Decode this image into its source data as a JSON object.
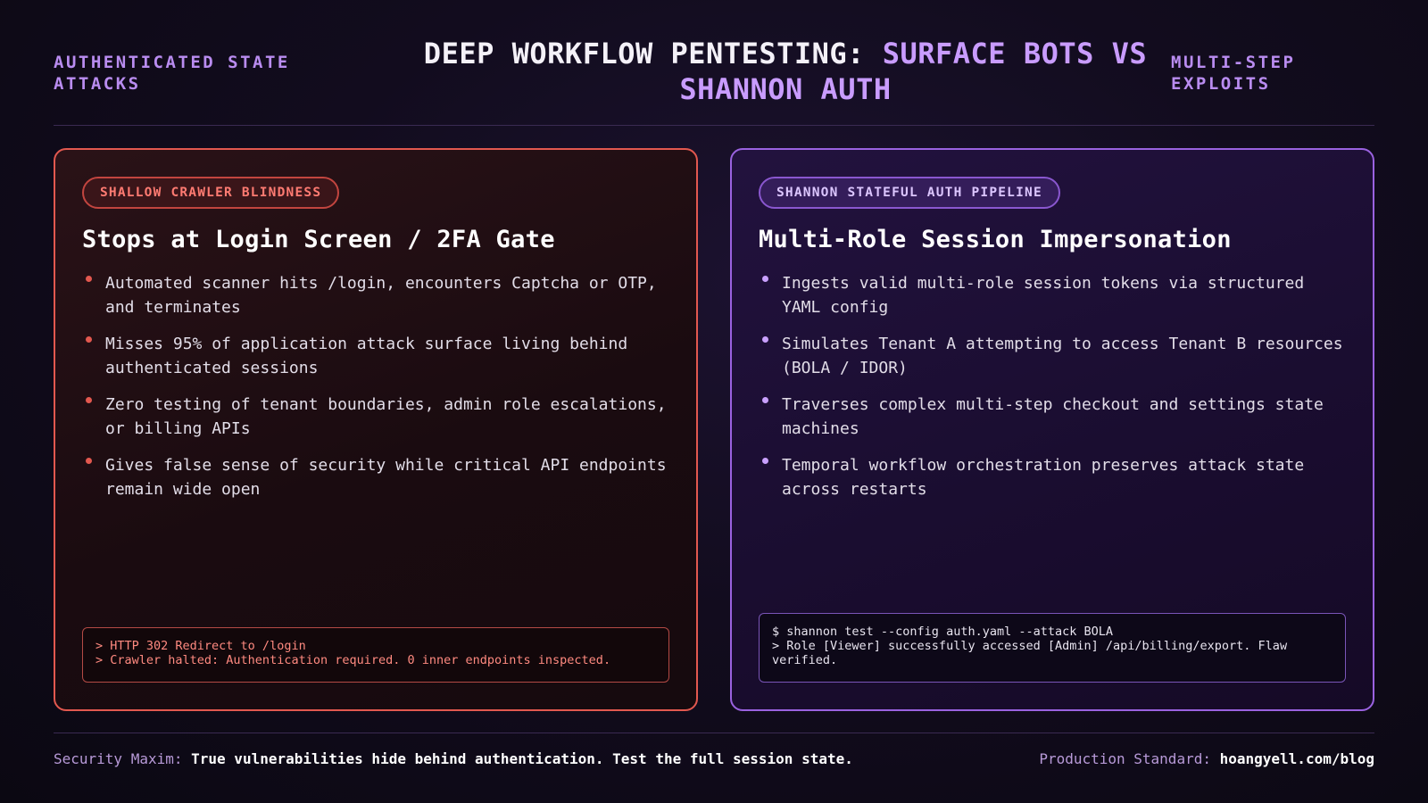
{
  "header": {
    "left_tag": "AUTHENTICATED STATE ATTACKS",
    "title_main": "DEEP WORKFLOW PENTESTING: ",
    "title_accent": "SURFACE BOTS VS SHANNON AUTH",
    "right_tag": "MULTI-STEP EXPLOITS"
  },
  "left_panel": {
    "pill": "SHALLOW CRAWLER BLINDNESS",
    "heading": "Stops at Login Screen / 2FA Gate",
    "bullets": [
      "Automated scanner hits /login, encounters Captcha or OTP, and terminates",
      "Misses 95% of application attack surface living behind authenticated sessions",
      "Zero testing of tenant boundaries, admin role escalations, or billing APIs",
      "Gives false sense of security while critical API endpoints remain wide open"
    ],
    "terminal": [
      "> HTTP 302 Redirect to /login",
      "> Crawler halted: Authentication required. 0 inner endpoints inspected."
    ]
  },
  "right_panel": {
    "pill": "SHANNON STATEFUL AUTH PIPELINE",
    "heading": "Multi-Role Session Impersonation",
    "bullets": [
      "Ingests valid multi-role session tokens via structured YAML config",
      "Simulates Tenant A attempting to access Tenant B resources (BOLA / IDOR)",
      "Traverses complex multi-step checkout and settings state machines",
      "Temporal workflow orchestration preserves attack state across restarts"
    ],
    "terminal": [
      "$ shannon test --config auth.yaml --attack BOLA",
      "> Role [Viewer] successfully accessed [Admin] /api/billing/export. Flaw verified."
    ]
  },
  "footer": {
    "left_label": "Security Maxim:",
    "left_text": "True vulnerabilities hide behind authentication. Test the full session state.",
    "right_label": "Production Standard:",
    "right_text": "hoangyell.com/blog"
  },
  "colors": {
    "left_accent": "#e2584f",
    "right_accent": "#9a62e0",
    "title_accent": "#c99cff"
  }
}
